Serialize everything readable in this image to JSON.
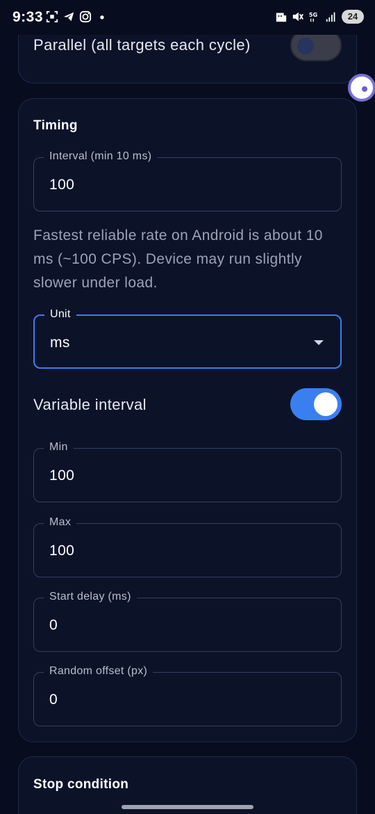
{
  "status_bar": {
    "time": "9:33",
    "left_icons": [
      "scan-icon",
      "telegram-icon",
      "instagram-icon",
      "dot-icon"
    ],
    "right_icons": [
      "calendar-icon",
      "mute-icon",
      "5g-icon",
      "signal-icon"
    ],
    "battery": "24"
  },
  "parallel": {
    "label": "Parallel (all targets each cycle)",
    "toggle_on": false
  },
  "timing": {
    "title": "Timing",
    "interval": {
      "label": "Interval (min 10 ms)",
      "value": "100"
    },
    "helper": "Fastest reliable rate on Android is about 10 ms (~100 CPS). Device may run slightly slower under load.",
    "unit": {
      "label": "Unit",
      "value": "ms"
    },
    "variable_interval": {
      "label": "Variable interval",
      "toggle_on": true
    },
    "min": {
      "label": "Min",
      "value": "100"
    },
    "max": {
      "label": "Max",
      "value": "100"
    },
    "start_delay": {
      "label": "Start delay (ms)",
      "value": "0"
    },
    "random_offset": {
      "label": "Random offset (px)",
      "value": "0"
    }
  },
  "stop": {
    "title": "Stop condition"
  },
  "colors": {
    "background": "#070c1e",
    "card": "#0c1329",
    "accent": "#3a7ff0"
  }
}
